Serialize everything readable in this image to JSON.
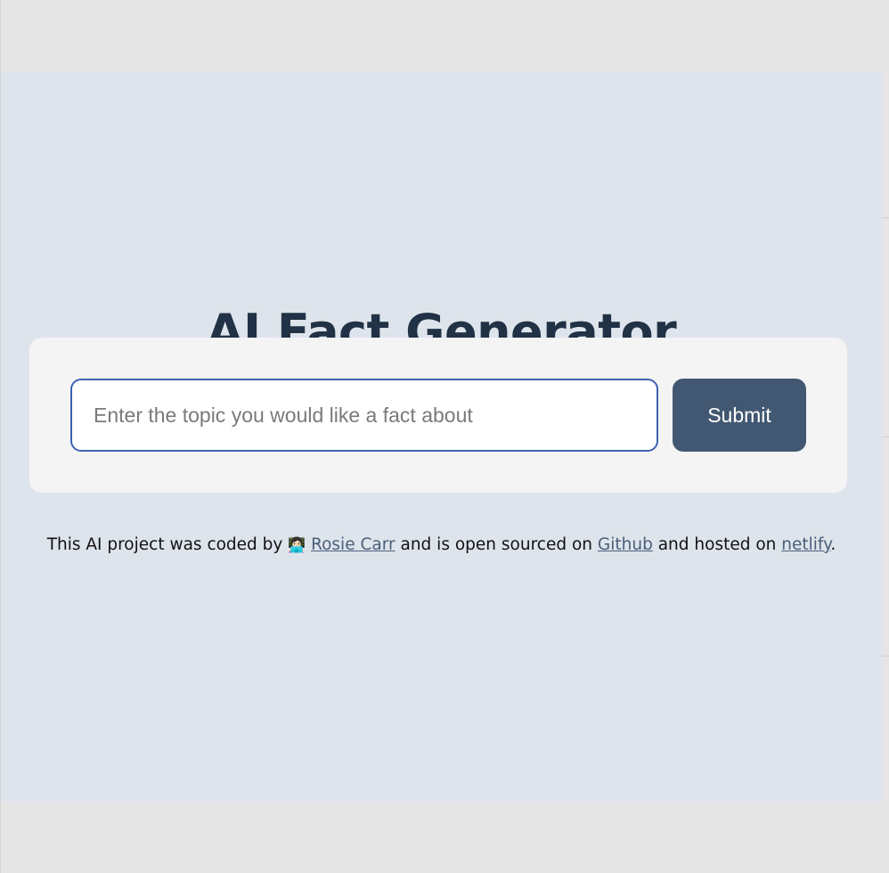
{
  "page": {
    "title": "AI Fact Generator"
  },
  "form": {
    "input_placeholder": "Enter the topic you would like a fact about",
    "input_value": "",
    "submit_label": "Submit"
  },
  "footer": {
    "text_before_author": "This AI project was coded by",
    "author_emoji": "👩🏻‍💻",
    "author_link": "Rosie Carr",
    "text_before_github": "and is open sourced on",
    "github_link": "Github",
    "text_before_netlify": "and hosted on",
    "netlify_link": "netlify",
    "text_end": "."
  },
  "colors": {
    "page_background": "#dee4eb",
    "title": "#213246",
    "card_background": "#f4f4f4",
    "input_border": "#3d62b3",
    "button_background": "#425771",
    "link": "#4a5f7a"
  }
}
